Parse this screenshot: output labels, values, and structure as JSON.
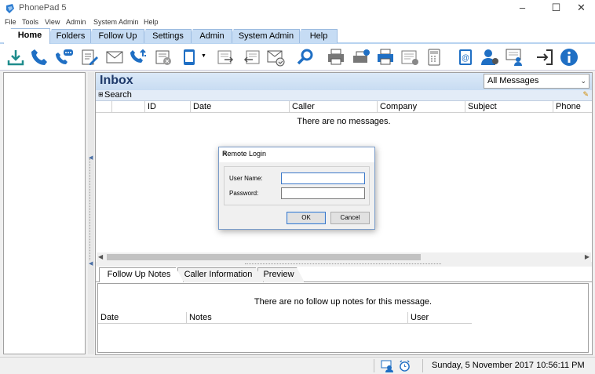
{
  "window": {
    "title": "PhonePad 5"
  },
  "menu": [
    "File",
    "Tools",
    "View",
    "Admin",
    "System Admin",
    "Help"
  ],
  "ribbon_tabs": [
    "Home",
    "Folders",
    "Follow Up",
    "Settings",
    "Admin",
    "System Admin",
    "Help"
  ],
  "toolbar_icons": [
    "download-icon",
    "phone-icon",
    "phone-chat-icon",
    "edit-note-icon",
    "envelope-icon",
    "phone-transfer-icon",
    "fax-icon",
    "mobile-icon",
    "forward-icon",
    "reply-icon",
    "mail-check-icon",
    "search-icon",
    "printer-icon",
    "print-settings-icon",
    "print-preview-icon",
    "report-icon",
    "calculator-icon",
    "email-book-icon",
    "user-settings-icon",
    "message-user-icon",
    "logout-icon",
    "info-icon"
  ],
  "inbox": {
    "title": "Inbox",
    "filter_value": "All Messages",
    "search_label": "Search",
    "columns": [
      "ID",
      "Date",
      "Caller",
      "Company",
      "Subject",
      "Phone"
    ],
    "empty_text": "There are no messages."
  },
  "bottom_tabs": [
    "Follow Up Notes",
    "Caller Information",
    "Preview"
  ],
  "notes": {
    "columns": [
      "Date",
      "Notes",
      "User"
    ],
    "empty_text": "There are no follow up notes for this message."
  },
  "status": {
    "datetime": "Sunday, 5 November 2017 10:56:11 PM"
  },
  "dialog": {
    "title": "Remote Login",
    "username_label": "User Name:",
    "password_label": "Password:",
    "username_value": "",
    "password_value": "",
    "ok_label": "OK",
    "cancel_label": "Cancel"
  },
  "colors": {
    "accent": "#1f6fc4",
    "ribbon": "#c6dcf4",
    "header_title": "#1f3a6a"
  }
}
